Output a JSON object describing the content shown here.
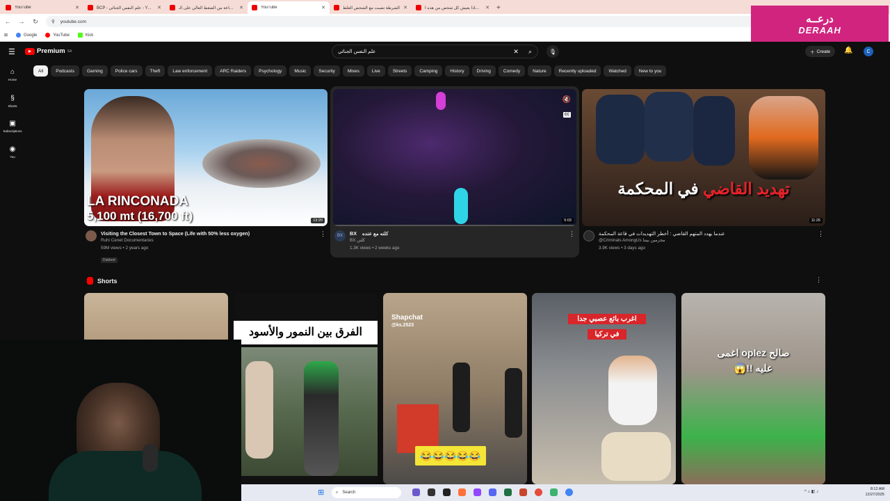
{
  "browser": {
    "tabs": [
      {
        "title": "YouTube",
        "active": false
      },
      {
        "title": "BCP - علم النفس الجنائي - YouTube",
        "active": false
      },
      {
        "title": "ساعة من الضغط العالي على الـ...",
        "active": false
      },
      {
        "title": "YouTube",
        "active": true
      },
      {
        "title": "الشرطة تصبت مع الشخص الغلط",
        "active": false
      },
      {
        "title": "لماذا يعيش كل شخص من هذه ا...",
        "active": false
      }
    ],
    "url": "youtube.com",
    "bookmarks": [
      "Google",
      "YouTube",
      "Kick"
    ]
  },
  "overlay": {
    "brand_ar": "درعــه",
    "brand_en": "DERAAH"
  },
  "header": {
    "logo_text": "Premium",
    "logo_region": "SA",
    "search_query": "علم النفس الجنائي",
    "create_label": "Create",
    "avatar_letter": "C"
  },
  "sidebar": [
    {
      "label": "Home",
      "icon": "home-icon",
      "glyph": "⌂"
    },
    {
      "label": "Shorts",
      "icon": "shorts-icon",
      "glyph": "§"
    },
    {
      "label": "Subscriptions",
      "icon": "subscriptions-icon",
      "glyph": "▣"
    },
    {
      "label": "You",
      "icon": "you-icon",
      "glyph": "◉"
    }
  ],
  "chips": [
    "All",
    "Podcasts",
    "Gaming",
    "Police cars",
    "Theft",
    "Law enforcement",
    "ARC Raiders",
    "Psychology",
    "Music",
    "Security",
    "Mixes",
    "Live",
    "Streets",
    "Camping",
    "History",
    "Driving",
    "Comedy",
    "Nature",
    "Recently uploaded",
    "Watched",
    "New to you"
  ],
  "videos": [
    {
      "title": "Visiting the Closest Town to Space (Life with 50% less oxygen)",
      "channel": "Ruhi Cenet Documentaries",
      "stats": "59M views • 2 years ago",
      "duration": "13:20",
      "badge": "Dubbed",
      "thumb_line1": "LA RINCONADA",
      "thumb_line2": "5,100 mt (16,700 ft)"
    },
    {
      "title": "كلنه مع عنده",
      "channel_handle": "BX",
      "channel": "BX كلنن",
      "stats": "1.3K views • 2 weeks ago",
      "duration": "5:03",
      "cc": "CC"
    },
    {
      "title": "عندما يهدد المتهم القاضي : أخطر التهديدات في قاعة المحكمة",
      "channel": "@Criminals AmongUs مجرمين بيننا",
      "stats": "3.9K views • 3 days ago",
      "duration": "11:26",
      "thumb_red": "تهديد القاضي",
      "thumb_white": "في المحكمة"
    }
  ],
  "shorts": {
    "heading": "Shorts",
    "items": [
      {
        "caption": ""
      },
      {
        "caption": "الفرق بين النمور والأسود"
      },
      {
        "caption": "Shapchat",
        "sub": "@ks.2523",
        "emoji": "😂😂😂😂😂"
      },
      {
        "caption": "اغرب بائع عصبي جدا",
        "sub": "في تركيا"
      },
      {
        "caption": "صالح oplez اغمى",
        "sub": "عليه !!😱"
      }
    ]
  },
  "taskbar": {
    "search_placeholder": "Search",
    "time": "8:12 AM",
    "date": "12/27/2025"
  }
}
